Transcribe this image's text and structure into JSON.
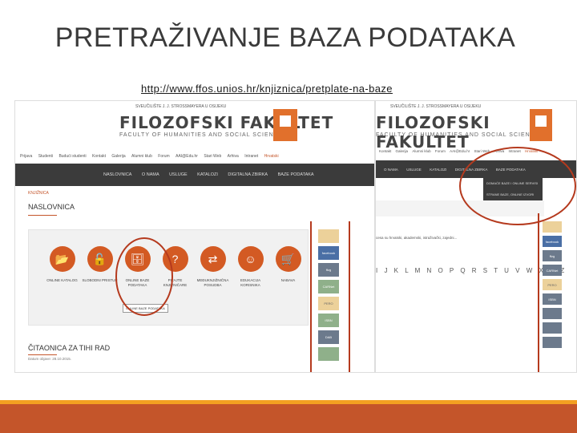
{
  "slide": {
    "title": "PRETRAŽIVANJE BAZA PODATAKA",
    "url": "http://www.ffos.unios.hr/knjiznica/pretplate-na-baze"
  },
  "shot1": {
    "university": "SVEUČILIŠTE J. J. STROSSMAYERA U OSIJEKU",
    "logo": "FILOZOFSKI FAKULTET",
    "subtitle": "FACULTY OF HUMANITIES AND SOCIAL SCIENCES",
    "top_links": [
      "Prijava",
      "Studenti",
      "Budući studenti",
      "Kontakt",
      "Galerija",
      "Alumni klub",
      "Forum",
      "AAI@Edu.hr",
      "Stari Web",
      "Arhiva",
      "Intranet",
      "Hrvatski"
    ],
    "nav": [
      "NASLOVNICA",
      "O NAMA",
      "USLUGE",
      "KATALOZI",
      "DIGITALNA ZBIRKA",
      "BAZE PODATAKA"
    ],
    "breadcrumb": "KNJIŽNICA",
    "heading": "NASLOVNICA",
    "icons": [
      {
        "glyph": "📂",
        "label": "ONLINE KATALOG"
      },
      {
        "glyph": "🔓",
        "label": "SLOBODNI PRISTUP"
      },
      {
        "glyph": "🗄",
        "label": "ONLINE BAZE PODATAKA"
      },
      {
        "glyph": "?",
        "label": "PITAJTE KNJIŽNIČARE"
      },
      {
        "glyph": "⇄",
        "label": "MEĐUKNJIŽNIČNA POSUDBA"
      },
      {
        "glyph": "☺",
        "label": "EDUKACIJA KORISNIKA"
      },
      {
        "glyph": "🛒",
        "label": "NABAVA"
      }
    ],
    "button": "ONLINE BAZE PODATAKA",
    "side": [
      "facebook",
      "ffzg",
      "CARNet",
      "PERO",
      "ISBN",
      "DAB",
      ""
    ],
    "heading2": "ČITAONICA ZA TIHI RAD",
    "date": "Datum objave: 28.10.2015."
  },
  "shot2": {
    "university": "SVEUČILIŠTE J. J. STROSSMAYERA U OSIJEKU",
    "logo": "FILOZOFSKI FAKULTET",
    "subtitle": "FACULTY OF HUMANITIES AND SOCIAL SCIENCES",
    "top_links": [
      "Kontakt",
      "Galerija",
      "Alumni klub",
      "Forum",
      "AAI@Edu.hr",
      "Stari Web",
      "Arhiva",
      "Intranet",
      "Hrvatski"
    ],
    "nav": [
      "O NAMA",
      "USLUGE",
      "KATALOZI",
      "DIGITALNA ZBIRKA",
      "BAZE PODATAKA"
    ],
    "dropdown": [
      "DOMAĆE BAZE I ONLINE SERVISI",
      "STRANE BAZE, ONLINE IZVORI"
    ],
    "text": "cesa su hrvatski, akademski, istraživački, zajedni...",
    "alphabet": "I J K L M N O P Q R S T U V W X Y Z",
    "side": [
      "facebook",
      "ffzg",
      "CARNet",
      "PERO",
      "ISBN",
      "",
      "",
      "",
      ""
    ]
  },
  "colors": {
    "accent": "#c4552a",
    "highlight": "#f3a021",
    "circle": "#b53a1e"
  }
}
